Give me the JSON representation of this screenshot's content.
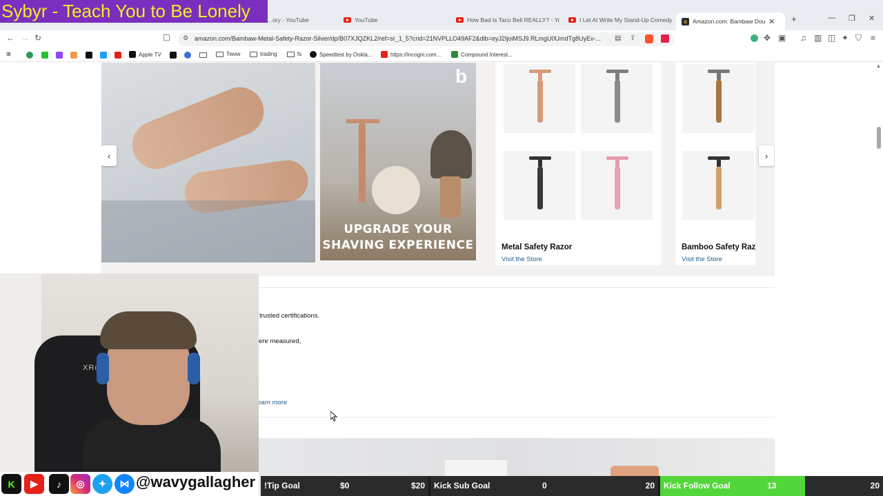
{
  "stream_title": "Sybyr - Teach You to Be Lonely",
  "browser": {
    "tabs": [
      {
        "label": "...ory - YouTube"
      },
      {
        "label": "YouTube"
      },
      {
        "label": "How Bad Is Taco Bell REALLY? - YouT..."
      },
      {
        "label": "I Let AI Write My Stand-Up Comedy"
      },
      {
        "label": "Amazon.com: Bambaw Double"
      }
    ],
    "new_tab": "+",
    "url": "amazon.com/Bambaw-Metal-Safety-Razor-Silver/dp/B07XJQZKL2/ref=sr_1_5?crid=21NVPLLO49AF2&dib=eyJ2IjoiMSJ9.RLmgU0UmdTg8UyEv-...",
    "bookmarks": [
      {
        "label": "Apple TV",
        "icon": "apple-tv-icon"
      },
      {
        "label": "Twow",
        "icon": "folder-icon"
      },
      {
        "label": "trading",
        "icon": "folder-icon"
      },
      {
        "label": "fs",
        "icon": "folder-icon"
      },
      {
        "label": "Speedtest by Ookla...",
        "icon": "speedtest-icon"
      },
      {
        "label": "https://incogni.com...",
        "icon": "youtube-icon"
      },
      {
        "label": "Compound Interest...",
        "icon": "bookmark-icon"
      }
    ]
  },
  "page": {
    "banner_text": "UPGRADE YOUR SHAVING EXPERIENCE",
    "brand_logo_char": "b",
    "products": [
      {
        "name": "Metal Safety Razor",
        "link": "Visit the Store"
      },
      {
        "name": "Bamboo Safety Raz",
        "link": "Visit the Store"
      }
    ],
    "prev_arrow": "‹",
    "next_arrow": "›",
    "text_line1": "trusted certifications.",
    "text_line2": "ere measured,",
    "learn_more": "earn more"
  },
  "social": {
    "handle": "@wavygallagher"
  },
  "goals": [
    {
      "label": "!Tip Goal",
      "current": "$0",
      "target": "$20",
      "progress": 0
    },
    {
      "label": "Kick Sub Goal",
      "current": "0",
      "target": "20",
      "progress": 0
    },
    {
      "label": "Kick Follow Goal",
      "current": "13",
      "target": "20",
      "progress": 0.65
    }
  ],
  "colors": {
    "stream_title_bg": "#7b2fbe",
    "stream_title_fg": "#f0f020",
    "amazon_link": "#1f5f8f",
    "goal_fill": "#53d63a"
  }
}
